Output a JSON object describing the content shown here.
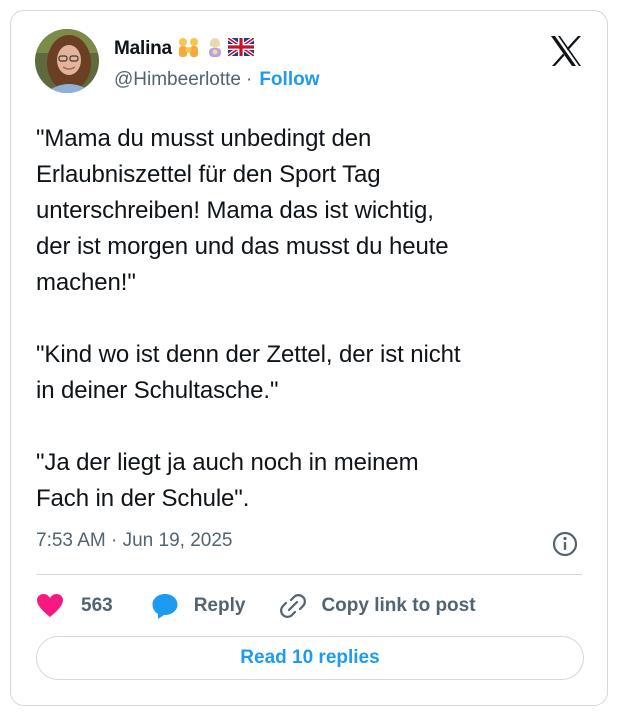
{
  "author": {
    "name": "Malina",
    "handle": "@Himbeerlotte",
    "emoji_icons": [
      "family-emoji-icon",
      "woman-emoji-icon",
      "uk-flag-icon"
    ]
  },
  "follow_label": "Follow",
  "handle_separator": "·",
  "tweet": {
    "text": "\"Mama du musst unbedingt den\nErlaubniszettel für den Sport Tag\nunterschreiben! Mama das ist wichtig,\nder ist morgen und das musst du heute\nmachen!\"\n\n\"Kind wo ist denn der Zettel, der ist nicht\nin deiner Schultasche.\"\n\n\"Ja der liegt ja auch noch in meinem\nFach in der Schule\".",
    "timestamp": "7:53 AM · Jun 19, 2025"
  },
  "actions": {
    "likes": "563",
    "reply_label": "Reply",
    "copy_label": "Copy link to post"
  },
  "read_replies_label": "Read 10 replies",
  "colors": {
    "accent": "#1d9bf0",
    "like": "#f91880",
    "secondary_text": "#536471",
    "border": "#cfd9de"
  }
}
